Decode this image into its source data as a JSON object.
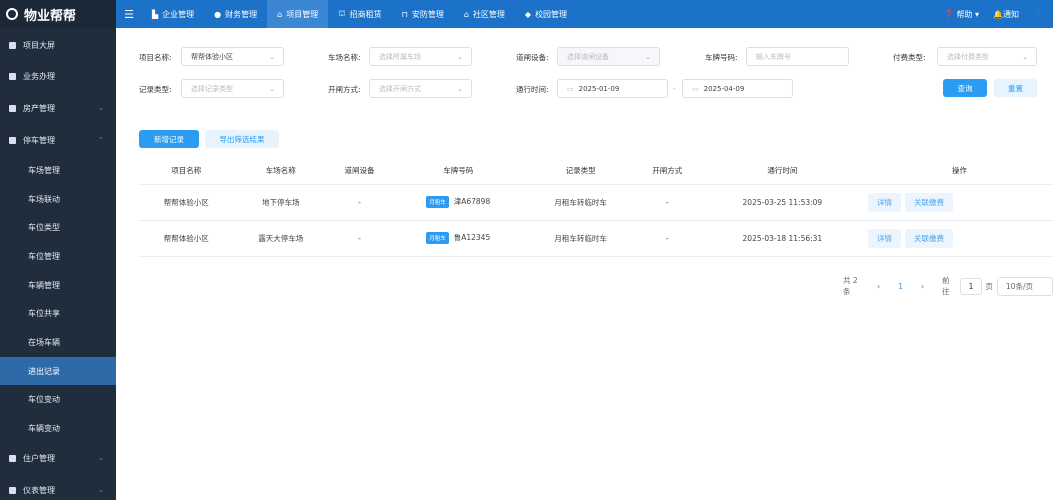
{
  "app": {
    "logo": "物业帮帮"
  },
  "sidebar": {
    "items": [
      {
        "label": "项目大屏",
        "icon": "screen-icon"
      },
      {
        "label": "业务办理",
        "icon": "desk-icon"
      },
      {
        "label": "房产管理",
        "icon": "building-icon"
      },
      {
        "label": "停车管理",
        "icon": "car-icon"
      }
    ],
    "parking_sub": [
      "车场管理",
      "车场联动",
      "车位类型",
      "车位管理",
      "车辆管理",
      "车位共享",
      "在场车辆",
      "进出记录",
      "车位变动",
      "车辆变动"
    ],
    "bottom": [
      "住户管理",
      "仪表管理"
    ],
    "active": "进出记录"
  },
  "topnav": {
    "items": [
      "企业管理",
      "财务管理",
      "项目管理",
      "招商租赁",
      "安防管理",
      "社区管理",
      "校园管理"
    ],
    "active": "项目管理",
    "help": "帮助",
    "notice": "通知"
  },
  "filters": {
    "project_label": "项目名称:",
    "project_value": "帮帮体验小区",
    "lot_label": "车场名称:",
    "lot_placeholder": "选择所属车场",
    "gate_label": "道闸设备:",
    "gate_placeholder": "选择道闸设备",
    "plate_label": "车牌号码:",
    "plate_placeholder": "输入车牌号",
    "pay_label": "付费类型:",
    "pay_placeholder": "选择付费类型",
    "record_label": "记录类型:",
    "record_placeholder": "选择记录类型",
    "open_label": "开闸方式:",
    "open_placeholder": "选择开闸方式",
    "time_label": "通行时间:",
    "start": "2025-01-09",
    "sep": "-",
    "end": "2025-04-09",
    "query": "查询",
    "reset": "重置"
  },
  "actions": {
    "add": "新增记录",
    "export": "导出筛选结果"
  },
  "table": {
    "headers": [
      "项目名称",
      "车场名称",
      "道闸设备",
      "车牌号码",
      "记录类型",
      "开闸方式",
      "通行时间",
      "操作"
    ],
    "rows": [
      {
        "project": "帮帮体验小区",
        "lot": "地下停车场",
        "gate": "-",
        "tag": "月租车",
        "plate": "津A67898",
        "type": "月租车转临时车",
        "open": "-",
        "time": "2025-03-25 11:53:09"
      },
      {
        "project": "帮帮体验小区",
        "lot": "露天大停车场",
        "gate": "-",
        "tag": "月租车",
        "plate": "鲁A12345",
        "type": "月租车转临时车",
        "open": "-",
        "time": "2025-03-18 11:56:31"
      }
    ],
    "detail": "详情",
    "link_pay": "关联缴费"
  },
  "pagination": {
    "total": "共 2 条",
    "prev": "‹",
    "page": "1",
    "next": "›",
    "goto": "前往",
    "goto_value": "1",
    "page_unit": "页",
    "size": "10条/页"
  }
}
